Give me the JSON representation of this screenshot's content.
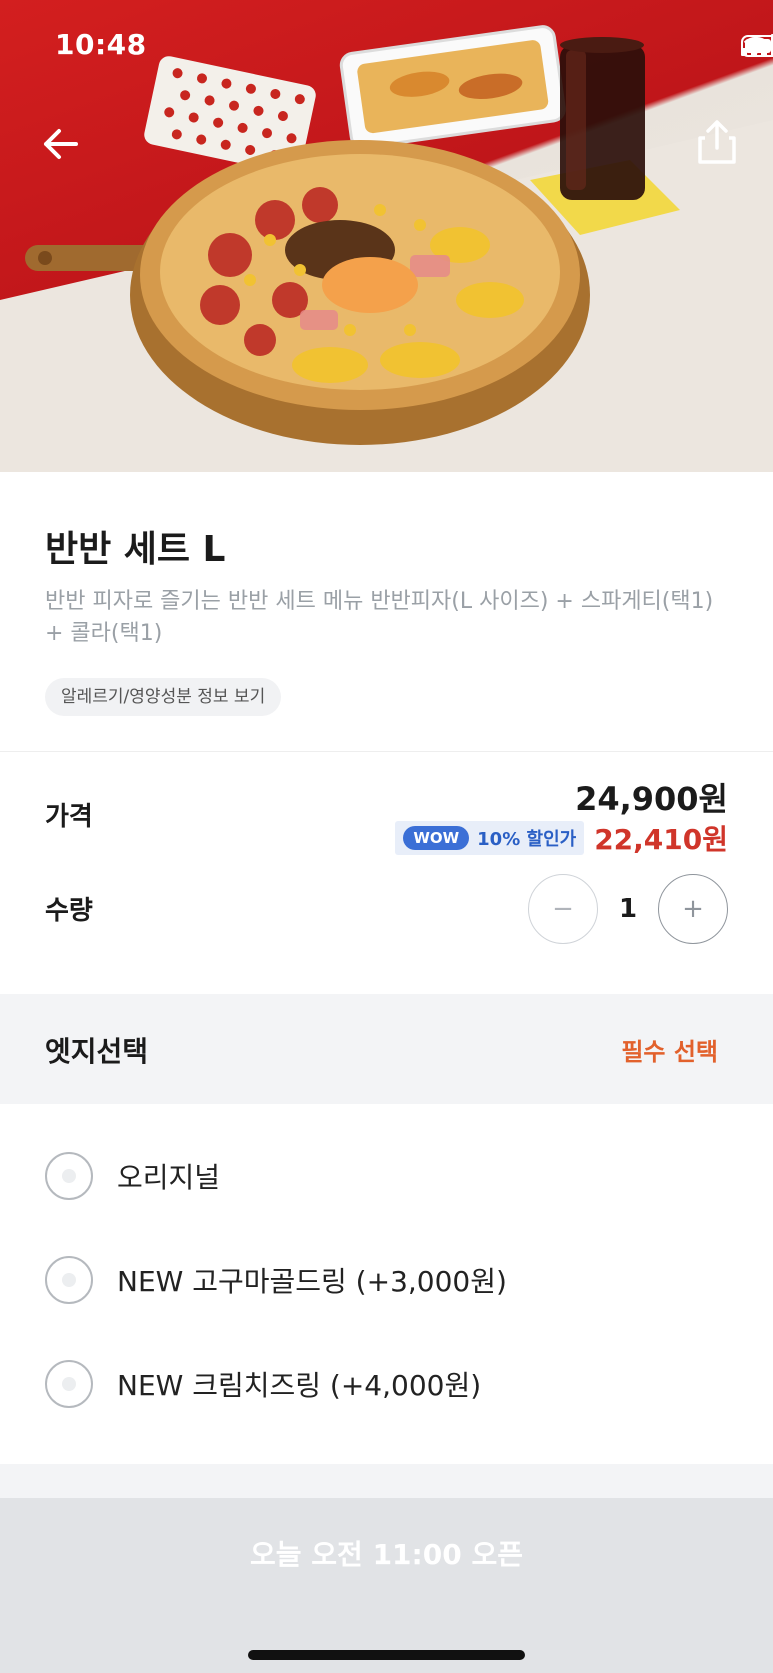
{
  "status_bar": {
    "time": "10:48"
  },
  "header": {
    "back_icon": "arrow-left-icon",
    "share_icon": "share-icon"
  },
  "product": {
    "title": "반반 세트 L",
    "description": "반반 피자로 즐기는 반반 세트 메뉴 반반피자(L 사이즈) + 스파게티(택1) + 콜라(택1)",
    "allergy_button": "알레르기/영양성분 정보 보기"
  },
  "price": {
    "label": "가격",
    "value": "24,900원",
    "wow_badge": "WOW",
    "wow_text": "10% 할인가",
    "wow_price": "22,410원"
  },
  "quantity": {
    "label": "수량",
    "value": "1",
    "minus": "−",
    "plus": "+"
  },
  "options": {
    "title": "엣지선택",
    "required": "필수 선택",
    "items": [
      {
        "label": "오리지널",
        "selected": false
      },
      {
        "label": "NEW 고구마골드링 (+3,000원)",
        "selected": false
      },
      {
        "label": "NEW 크림치즈링 (+4,000원)",
        "selected": false
      }
    ]
  },
  "bottom": {
    "open_text": "오늘 오전 11:00 오픈"
  },
  "colors": {
    "accent_red": "#d0352a",
    "wow_blue": "#3b6fd6",
    "required_orange": "#e2612c"
  }
}
